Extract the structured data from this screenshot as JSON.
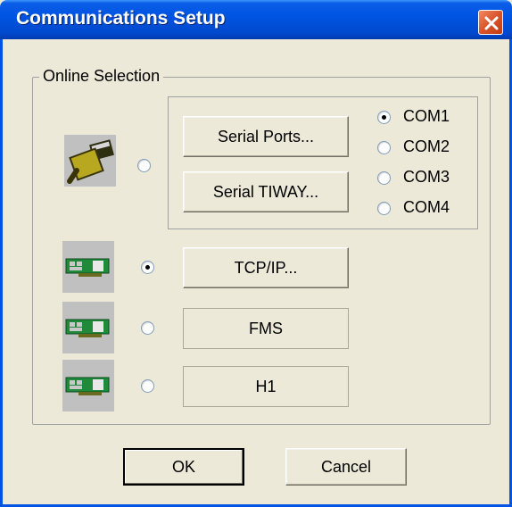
{
  "window": {
    "title": "Communications Setup"
  },
  "online_selection": {
    "label": "Online Selection",
    "serial_ports_label": "Serial Ports...",
    "serial_tiway_label": "Serial TIWAY...",
    "com_ports": [
      {
        "label": "COM1",
        "selected": true
      },
      {
        "label": "COM2",
        "selected": false
      },
      {
        "label": "COM3",
        "selected": false
      },
      {
        "label": "COM4",
        "selected": false
      }
    ],
    "tcpip_label": "TCP/IP...",
    "fms_label": "FMS",
    "h1_label": "H1",
    "selected_connection": "TCP/IP"
  },
  "footer": {
    "ok_label": "OK",
    "cancel_label": "Cancel"
  },
  "colors": {
    "titlebar": "#0054e3",
    "dialog_bg": "#ece9d8",
    "close": "#d9542c"
  }
}
